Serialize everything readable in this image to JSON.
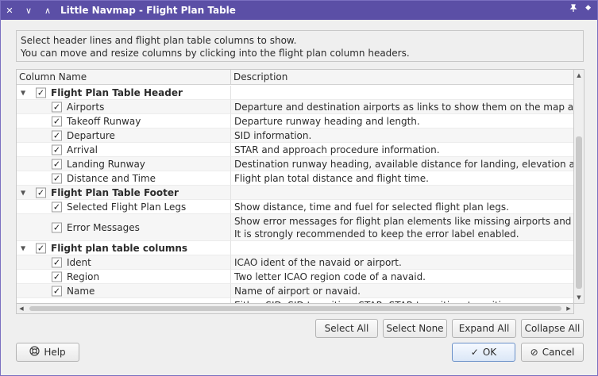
{
  "window": {
    "title": "Little Navmap - Flight Plan Table",
    "controls": {
      "close": "✕",
      "minimize": "∨",
      "maximize": "∧",
      "pin": "📌",
      "shade": "◆"
    }
  },
  "info": {
    "line1": "Select header lines and flight plan table columns to show.",
    "line2": "You can move and resize columns by clicking into the flight plan column headers."
  },
  "tree": {
    "headers": [
      "Column Name",
      "Description"
    ],
    "rows": [
      {
        "label": "Flight Plan Table Header",
        "desc": "",
        "desc2": "",
        "group": true,
        "checked": true
      },
      {
        "label": "Airports",
        "desc": "Departure and destination airports as links to show them on the map and in …",
        "desc2": "",
        "group": false,
        "checked": true
      },
      {
        "label": "Takeoff Runway",
        "desc": "Departure runway heading and length.",
        "desc2": "",
        "group": false,
        "checked": true
      },
      {
        "label": "Departure",
        "desc": "SID information.",
        "desc2": "",
        "group": false,
        "checked": true
      },
      {
        "label": "Arrival",
        "desc": "STAR and approach procedure information.",
        "desc2": "",
        "group": false,
        "checked": true
      },
      {
        "label": "Landing Runway",
        "desc": "Destination runway heading, available distance for landing, elevation and …",
        "desc2": "",
        "group": false,
        "checked": true
      },
      {
        "label": "Distance and Time",
        "desc": "Flight plan total distance and flight time.",
        "desc2": "",
        "group": false,
        "checked": true
      },
      {
        "label": "Flight Plan Table Footer",
        "desc": "",
        "desc2": "",
        "group": true,
        "checked": true
      },
      {
        "label": "Selected Flight Plan Legs",
        "desc": "Show distance, time and fuel for selected flight plan legs.",
        "desc2": "",
        "group": false,
        "checked": true
      },
      {
        "label": "Error Messages",
        "desc": "Show error messages for flight plan elements like missing airports and more.",
        "desc2": "It is strongly recommended to keep the error label enabled.",
        "group": false,
        "checked": true
      },
      {
        "label": "Flight plan table columns",
        "desc": "",
        "desc2": "",
        "group": true,
        "checked": true
      },
      {
        "label": "Ident",
        "desc": "ICAO ident of the navaid or airport.",
        "desc2": "",
        "group": false,
        "checked": true
      },
      {
        "label": "Region",
        "desc": "Two letter ICAO region code of a navaid.",
        "desc2": "",
        "group": false,
        "checked": true
      },
      {
        "label": "Name",
        "desc": "Name of airport or navaid.",
        "desc2": "",
        "group": false,
        "checked": true
      },
      {
        "label": "",
        "desc": "Either SID, SID transition, STAR, STAR transition, transition",
        "desc2": "",
        "group": false,
        "checked": false
      }
    ]
  },
  "buttons": {
    "select_all": "Select All",
    "select_none": "Select None",
    "expand_all": "Expand All",
    "collapse_all": "Collapse All",
    "help": "Help",
    "ok": "OK",
    "cancel": "Cancel"
  },
  "icons": {
    "checkmark": "✓",
    "expanded": "▼",
    "help": "🛟",
    "ok": "✓",
    "cancel": "⊘"
  }
}
